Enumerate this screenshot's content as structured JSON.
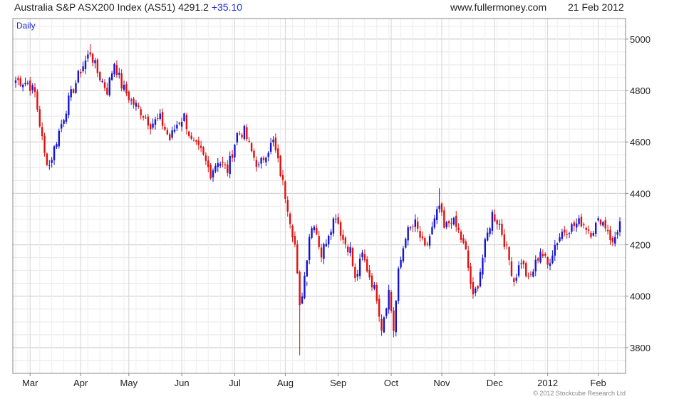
{
  "header": {
    "title": "Australia S&P ASX200 Index (AS51) 4291.2",
    "change": "+35.10",
    "site": "www.fullermoney.com",
    "date": "21 Feb 2012"
  },
  "copyright": "© 2012 Stockcube Research Ltd",
  "chart_data": {
    "type": "candlestick",
    "period_label": "Daily",
    "ylim": [
      3700,
      5080
    ],
    "y_ticks": [
      3800,
      4000,
      4200,
      4400,
      4600,
      4800,
      5000
    ],
    "x_ticks": [
      {
        "label": "Mar",
        "index": 6
      },
      {
        "label": "Apr",
        "index": 27
      },
      {
        "label": "May",
        "index": 47
      },
      {
        "label": "Jun",
        "index": 69
      },
      {
        "label": "Jul",
        "index": 91
      },
      {
        "label": "Aug",
        "index": 112
      },
      {
        "label": "Sep",
        "index": 134
      },
      {
        "label": "Oct",
        "index": 156
      },
      {
        "label": "Nov",
        "index": 177
      },
      {
        "label": "Dec",
        "index": 199
      },
      {
        "label": "2012",
        "index": 221
      },
      {
        "label": "Feb",
        "index": 242
      }
    ],
    "num_bars": 252,
    "up_color": "#1414d2",
    "down_color": "#e01010",
    "close_anchors": [
      [
        0,
        4840
      ],
      [
        5,
        4830
      ],
      [
        8,
        4790
      ],
      [
        12,
        4550
      ],
      [
        14,
        4510
      ],
      [
        18,
        4640
      ],
      [
        22,
        4760
      ],
      [
        27,
        4880
      ],
      [
        31,
        4950
      ],
      [
        34,
        4870
      ],
      [
        38,
        4800
      ],
      [
        41,
        4910
      ],
      [
        44,
        4820
      ],
      [
        48,
        4760
      ],
      [
        52,
        4720
      ],
      [
        56,
        4670
      ],
      [
        60,
        4690
      ],
      [
        64,
        4610
      ],
      [
        67,
        4670
      ],
      [
        70,
        4700
      ],
      [
        73,
        4600
      ],
      [
        77,
        4560
      ],
      [
        81,
        4480
      ],
      [
        84,
        4530
      ],
      [
        88,
        4490
      ],
      [
        92,
        4630
      ],
      [
        95,
        4640
      ],
      [
        98,
        4560
      ],
      [
        101,
        4500
      ],
      [
        104,
        4560
      ],
      [
        107,
        4600
      ],
      [
        110,
        4480
      ],
      [
        113,
        4350
      ],
      [
        116,
        4200
      ],
      [
        118,
        3950
      ],
      [
        120,
        4080
      ],
      [
        122,
        4240
      ],
      [
        124,
        4290
      ],
      [
        127,
        4160
      ],
      [
        130,
        4250
      ],
      [
        133,
        4320
      ],
      [
        136,
        4220
      ],
      [
        139,
        4180
      ],
      [
        141,
        4060
      ],
      [
        144,
        4160
      ],
      [
        147,
        4080
      ],
      [
        150,
        4000
      ],
      [
        152,
        3880
      ],
      [
        155,
        4020
      ],
      [
        157,
        3870
      ],
      [
        159,
        4090
      ],
      [
        162,
        4240
      ],
      [
        166,
        4280
      ],
      [
        170,
        4180
      ],
      [
        173,
        4260
      ],
      [
        176,
        4350
      ],
      [
        178,
        4260
      ],
      [
        181,
        4300
      ],
      [
        184,
        4250
      ],
      [
        187,
        4170
      ],
      [
        190,
        3990
      ],
      [
        192,
        4050
      ],
      [
        195,
        4200
      ],
      [
        198,
        4320
      ],
      [
        201,
        4280
      ],
      [
        204,
        4180
      ],
      [
        207,
        4060
      ],
      [
        210,
        4140
      ],
      [
        213,
        4060
      ],
      [
        215,
        4100
      ],
      [
        218,
        4180
      ],
      [
        221,
        4120
      ],
      [
        224,
        4200
      ],
      [
        227,
        4250
      ],
      [
        231,
        4270
      ],
      [
        235,
        4290
      ],
      [
        239,
        4250
      ],
      [
        243,
        4300
      ],
      [
        246,
        4260
      ],
      [
        248,
        4200
      ],
      [
        251,
        4291.2
      ]
    ],
    "highlights": [
      {
        "index": 118,
        "low": 3770
      },
      {
        "index": 121,
        "high": 4040
      },
      {
        "index": 157,
        "low": 3840
      },
      {
        "index": 176,
        "high": 4420
      },
      {
        "index": 31,
        "high": 4980
      }
    ]
  }
}
